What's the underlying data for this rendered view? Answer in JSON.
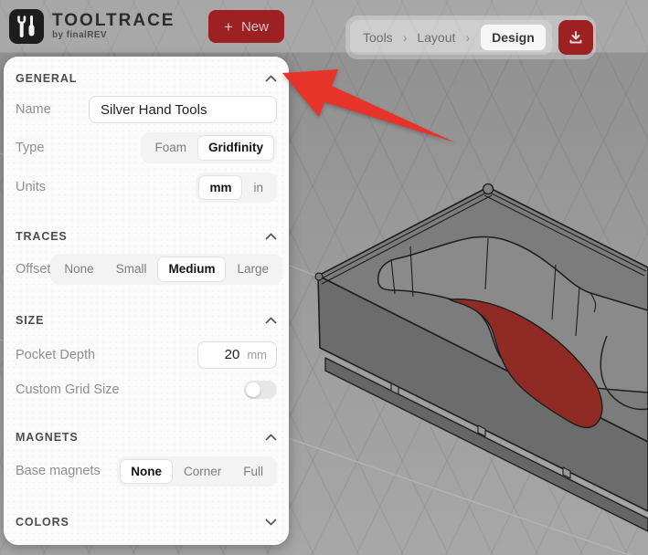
{
  "colors": {
    "accent_red": "#9d2123",
    "arrow_red": "#e6342a",
    "pocket_red": "#8f2b24",
    "tray_gray": "#7c7c7c"
  },
  "header": {
    "brand": {
      "name": "TOOLTRACE",
      "byline": "by finalREV"
    },
    "new_button": {
      "icon": "+",
      "label": "New"
    }
  },
  "breadcrumb": {
    "items": [
      "Tools",
      "Layout",
      "Design"
    ],
    "separator": "›",
    "active": "Design"
  },
  "panel": {
    "general": {
      "title": "GENERAL",
      "name_label": "Name",
      "name_value": "Silver Hand Tools",
      "type_label": "Type",
      "type_options": [
        "Foam",
        "Gridfinity"
      ],
      "type_selected": "Gridfinity",
      "units_label": "Units",
      "units_options": [
        "mm",
        "in"
      ],
      "units_selected": "mm"
    },
    "traces": {
      "title": "TRACES",
      "offset_label": "Offset",
      "offset_options": [
        "None",
        "Small",
        "Medium",
        "Large"
      ],
      "offset_selected": "Medium"
    },
    "size": {
      "title": "SIZE",
      "pocket_depth_label": "Pocket Depth",
      "pocket_depth_value": "20",
      "pocket_depth_unit": "mm",
      "custom_grid_label": "Custom Grid Size",
      "custom_grid_enabled": false
    },
    "magnets": {
      "title": "MAGNETS",
      "base_label": "Base magnets",
      "base_options": [
        "None",
        "Corner",
        "Full"
      ],
      "base_selected": "None"
    },
    "colors_section": {
      "title": "COLORS",
      "collapsed": true
    }
  },
  "viewport": {
    "description": "3D preview of Gridfinity tray with red tool pocket"
  }
}
